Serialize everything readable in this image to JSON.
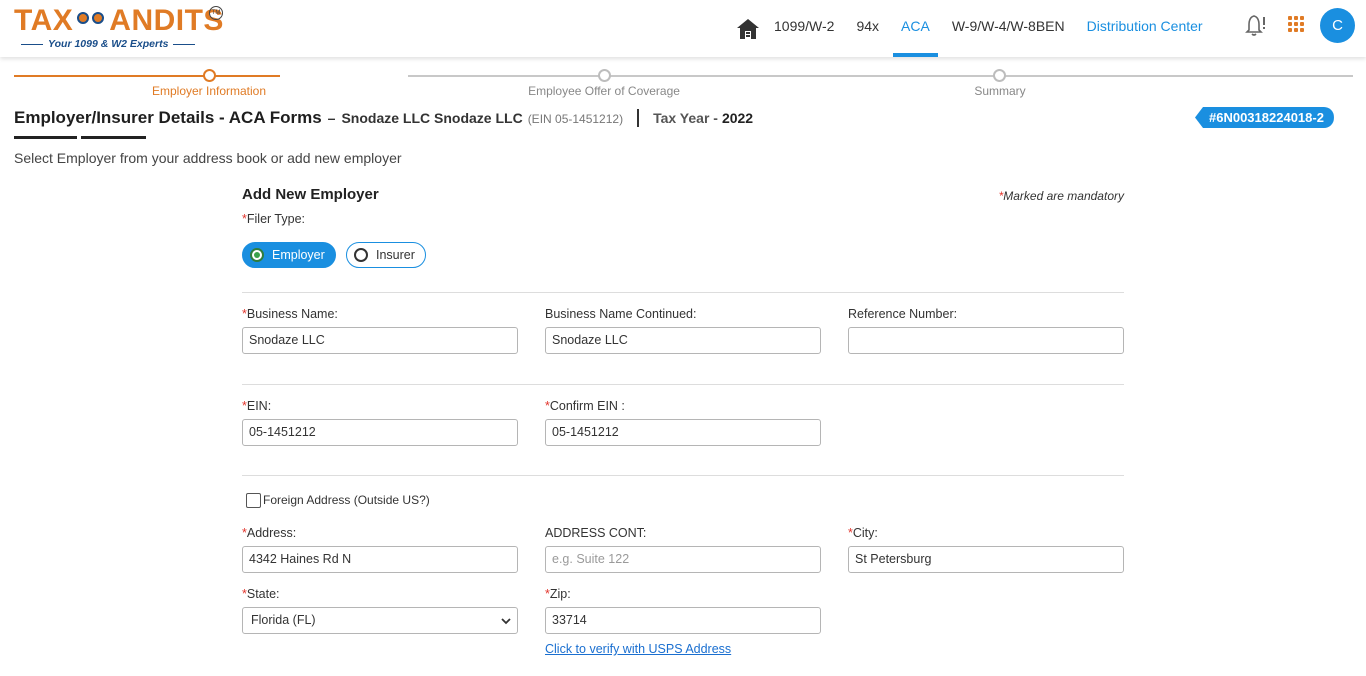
{
  "brand": {
    "logo_left": "TAX",
    "logo_right": "ANDITS",
    "tm": "TM",
    "tagline": "Your 1099 & W2 Experts"
  },
  "nav": {
    "items": [
      "1099/W-2",
      "94x",
      "ACA",
      "W-9/W-4/W-8BEN",
      "Distribution Center"
    ],
    "active": "ACA",
    "avatar_initial": "C"
  },
  "stepper": {
    "steps": [
      "Employer Information",
      "Employee Offer of Coverage",
      "Summary"
    ],
    "active_index": 0
  },
  "header": {
    "title": "Employer/Insurer Details - ACA Forms",
    "dash": "–",
    "company": "Snodaze LLC Snodaze LLC",
    "ein": "(EIN 05-1451212)",
    "tax_year_label": "Tax Year -",
    "tax_year": "2022",
    "order_id": "#6N00318224018-2"
  },
  "hint": "Select Employer from your address book or add new employer",
  "form": {
    "title": "Add New Employer",
    "mandatory_note": "Marked are mandatory",
    "required_mark": "*",
    "filer_type_label": "Filer Type:",
    "filer_options": [
      "Employer",
      "Insurer"
    ],
    "filer_selected": "Employer",
    "business_name_label": "Business Name:",
    "business_name_value": "Snodaze LLC",
    "business_name_cont_label": "Business Name Continued:",
    "business_name_cont_value": "Snodaze LLC",
    "reference_number_label": "Reference Number:",
    "reference_number_value": "",
    "ein_label": "EIN:",
    "ein_value": "05-1451212",
    "confirm_ein_label": "Confirm EIN :",
    "confirm_ein_value": "05-1451212",
    "foreign_address_label": "Foreign Address (Outside US?)",
    "foreign_address_checked": false,
    "address_label": "Address:",
    "address_value": "4342 Haines Rd N",
    "address_cont_label": "ADDRESS CONT:",
    "address_cont_placeholder": "e.g. Suite 122",
    "city_label": "City:",
    "city_value": "St Petersburg",
    "state_label": "State:",
    "state_value": "Florida (FL)",
    "zip_label": "Zip:",
    "zip_value": "33714",
    "verify_link": "Click to verify with USPS Address"
  },
  "colors": {
    "brand_orange": "#e07b25",
    "brand_blue": "#1a8fe0",
    "required_red": "#e2342b"
  }
}
